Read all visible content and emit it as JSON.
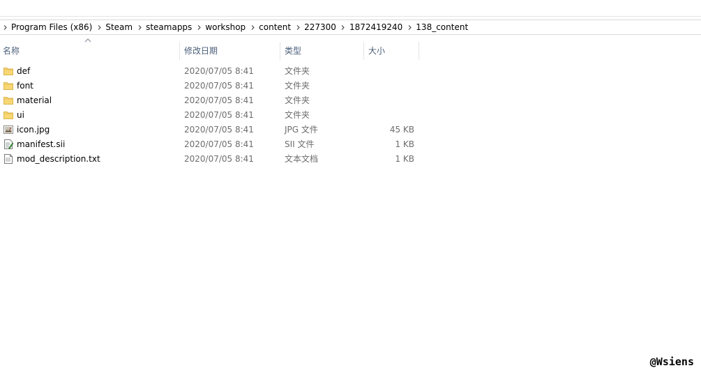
{
  "breadcrumb": [
    "Program Files (x86)",
    "Steam",
    "steamapps",
    "workshop",
    "content",
    "227300",
    "1872419240",
    "138_content"
  ],
  "columns": {
    "name": "名称",
    "date": "修改日期",
    "type": "类型",
    "size": "大小"
  },
  "files": [
    {
      "name": "def",
      "date": "2020/07/05 8:41",
      "type": "文件夹",
      "size": "",
      "icon": "folder-icon"
    },
    {
      "name": "font",
      "date": "2020/07/05 8:41",
      "type": "文件夹",
      "size": "",
      "icon": "folder-icon"
    },
    {
      "name": "material",
      "date": "2020/07/05 8:41",
      "type": "文件夹",
      "size": "",
      "icon": "folder-icon"
    },
    {
      "name": "ui",
      "date": "2020/07/05 8:41",
      "type": "文件夹",
      "size": "",
      "icon": "folder-icon"
    },
    {
      "name": "icon.jpg",
      "date": "2020/07/05 8:41",
      "type": "JPG 文件",
      "size": "45 KB",
      "icon": "image-file-icon"
    },
    {
      "name": "manifest.sii",
      "date": "2020/07/05 8:41",
      "type": "SII 文件",
      "size": "1 KB",
      "icon": "script-file-icon"
    },
    {
      "name": "mod_description.txt",
      "date": "2020/07/05 8:41",
      "type": "文本文档",
      "size": "1 KB",
      "icon": "text-file-icon"
    }
  ],
  "watermark": "@Wsiens"
}
